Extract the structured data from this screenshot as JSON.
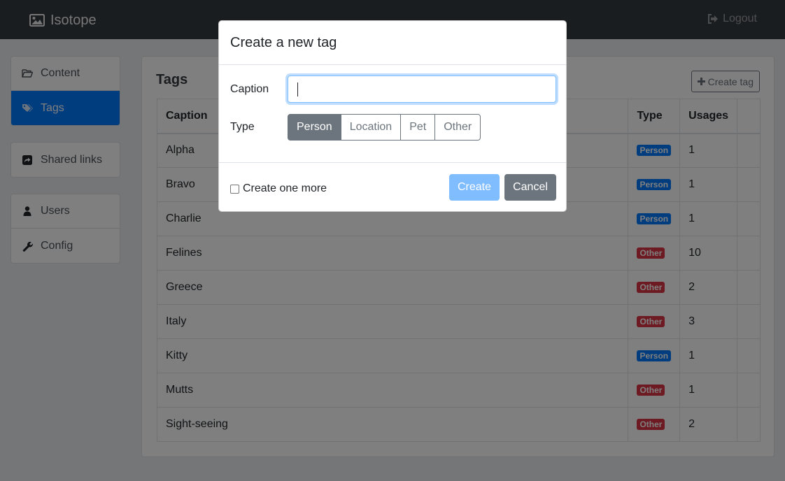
{
  "navbar": {
    "brand": "Isotope",
    "brand_icon": "image-icon",
    "logout_label": "Logout",
    "logout_icon": "sign-out-icon"
  },
  "sidebar": {
    "group1": [
      {
        "label": "Content",
        "icon": "folder-open-icon"
      },
      {
        "label": "Tags",
        "icon": "tags-icon",
        "active": true
      }
    ],
    "group2": [
      {
        "label": "Shared links",
        "icon": "share-square-icon"
      }
    ],
    "group3": [
      {
        "label": "Users",
        "icon": "user-icon"
      },
      {
        "label": "Config",
        "icon": "wrench-icon"
      }
    ]
  },
  "main": {
    "title": "Tags",
    "create_button": "Create tag",
    "columns": [
      "Caption",
      "Type",
      "Usages",
      ""
    ],
    "rows": [
      {
        "caption": "Alpha",
        "type": "Person",
        "usages": "1"
      },
      {
        "caption": "Bravo",
        "type": "Person",
        "usages": "1"
      },
      {
        "caption": "Charlie",
        "type": "Person",
        "usages": "1"
      },
      {
        "caption": "Felines",
        "type": "Other",
        "usages": "10"
      },
      {
        "caption": "Greece",
        "type": "Other",
        "usages": "2"
      },
      {
        "caption": "Italy",
        "type": "Other",
        "usages": "3"
      },
      {
        "caption": "Kitty",
        "type": "Person",
        "usages": "1"
      },
      {
        "caption": "Mutts",
        "type": "Other",
        "usages": "1"
      },
      {
        "caption": "Sight-seeing",
        "type": "Other",
        "usages": "2"
      }
    ],
    "badge_colors": {
      "Person": "#007bff",
      "Other": "#dc3545"
    }
  },
  "modal": {
    "title": "Create a new tag",
    "caption_label": "Caption",
    "caption_value": "",
    "type_label": "Type",
    "type_options": [
      "Person",
      "Location",
      "Pet",
      "Other"
    ],
    "type_selected": "Person",
    "create_one_more_label": "Create one more",
    "create_one_more_checked": false,
    "create_button": "Create",
    "cancel_button": "Cancel"
  }
}
